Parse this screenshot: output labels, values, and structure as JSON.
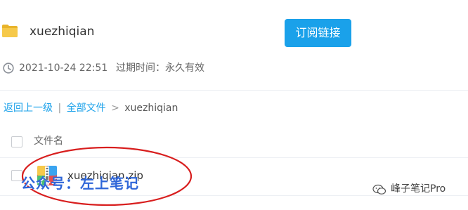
{
  "header": {
    "folder_name": "xuezhiqian",
    "subscribe_label": "订阅链接"
  },
  "meta": {
    "created": "2021-10-24 22:51",
    "expire": "过期时间：永久有效"
  },
  "breadcrumb": {
    "back": "返回上一级",
    "separator1": "|",
    "all_files": "全部文件",
    "separator2": ">",
    "current": "xuezhiqian"
  },
  "table": {
    "column_header": "文件名",
    "rows": [
      {
        "name": "xuezhiqian.zip"
      }
    ]
  },
  "watermarks": {
    "left": "公众号：左上笔记",
    "right": "峰子笔记Pro"
  },
  "colors": {
    "accent": "#1aa1ea",
    "annotation": "#d81e1e",
    "watermark": "#2f66d8"
  },
  "icons": {
    "folder": "folder-icon",
    "clock": "clock-icon",
    "zip": "zip-file-icon",
    "wechat": "wechat-icon"
  }
}
